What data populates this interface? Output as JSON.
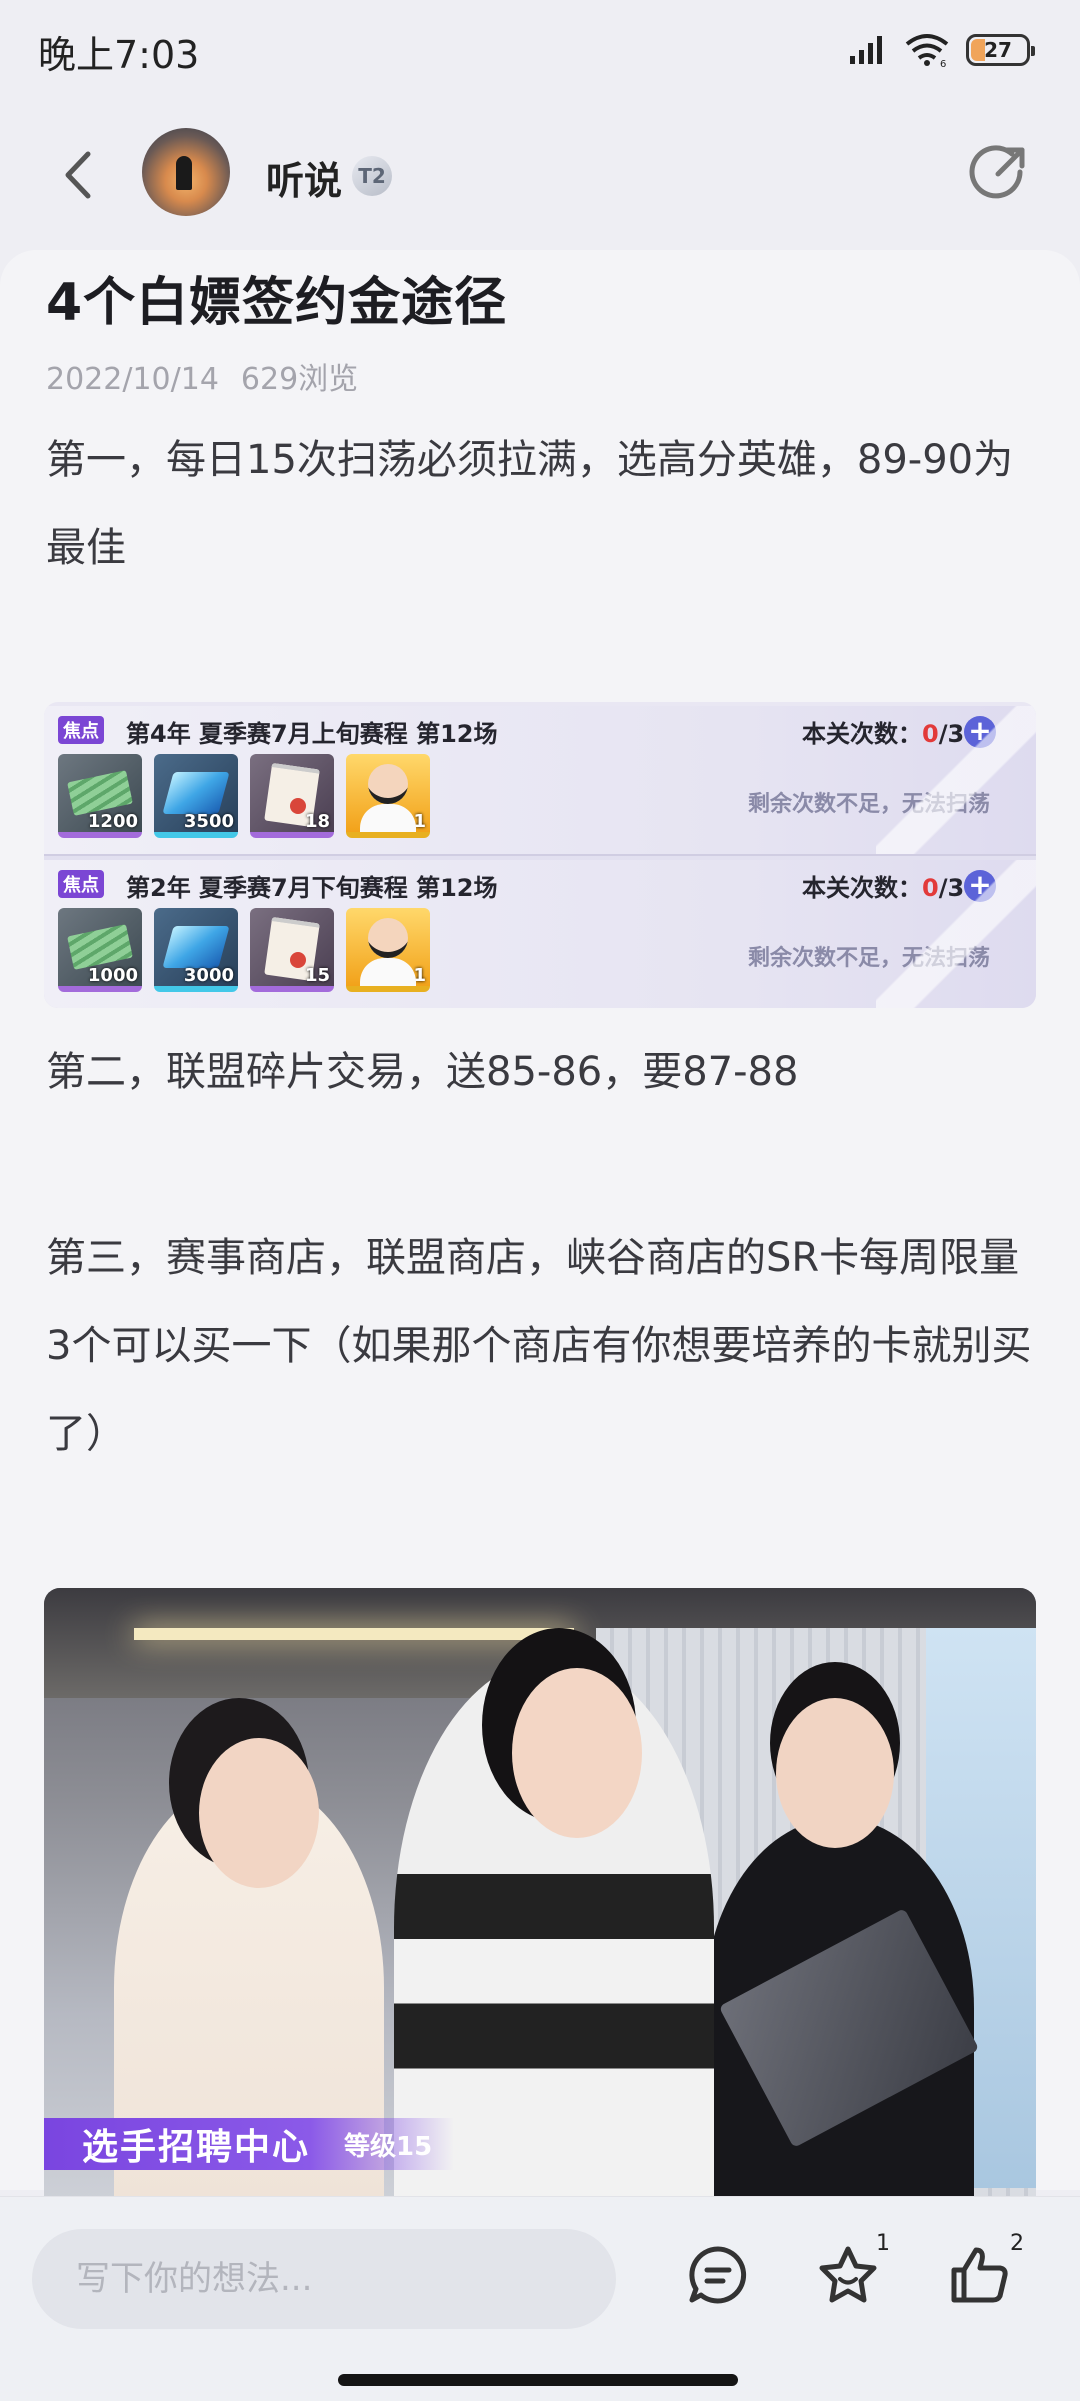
{
  "status_bar": {
    "time": "晚上7:03",
    "wifi_label": "6",
    "battery": "27"
  },
  "header": {
    "author": "听说",
    "level_badge": "T2"
  },
  "post": {
    "title": "4个白嫖签约金途径",
    "date": "2022/10/14",
    "views": "629浏览",
    "paragraph_1": "第一，每日15次扫荡必须拉满，选高分英雄，89-90为最佳",
    "paragraph_2": "第二，联盟碎片交易，送85-86，要87-88",
    "paragraph_3": "第三，赛事商店，联盟商店，峡谷商店的SR卡每周限量3个可以买一下（如果那个商店有你想要培养的卡就别买了）"
  },
  "sweep_screenshot": {
    "rows": [
      {
        "tag": "焦点",
        "stage": "第4年 夏季赛7月上旬赛程 第12场",
        "count_label": "本关次数：",
        "count_used": "0",
        "count_total": "/3",
        "note": "剩余次数不足，无法扫荡",
        "rewards": [
          "1200",
          "3500",
          "18",
          "1"
        ]
      },
      {
        "tag": "焦点",
        "stage": "第2年 夏季赛7月下旬赛程 第12场",
        "count_label": "本关次数：",
        "count_used": "0",
        "count_total": "/3",
        "note": "剩余次数不足，无法扫荡",
        "rewards": [
          "1000",
          "3000",
          "15",
          "1"
        ]
      }
    ]
  },
  "recruit_image": {
    "title": "选手招聘中心",
    "level": "等级15"
  },
  "bottom_bar": {
    "comment_placeholder": "写下你的想法...",
    "favorite_count": "1",
    "like_count": "2"
  },
  "colors": {
    "accent_purple": "#7b46d4",
    "count_red": "#e23a3a",
    "plus_blue": "#5c63d8"
  },
  "icons": [
    "back-arrow-icon",
    "share-icon",
    "comment-icon",
    "star-icon",
    "thumbs-up-icon",
    "signal-icon",
    "wifi-icon",
    "battery-icon"
  ]
}
